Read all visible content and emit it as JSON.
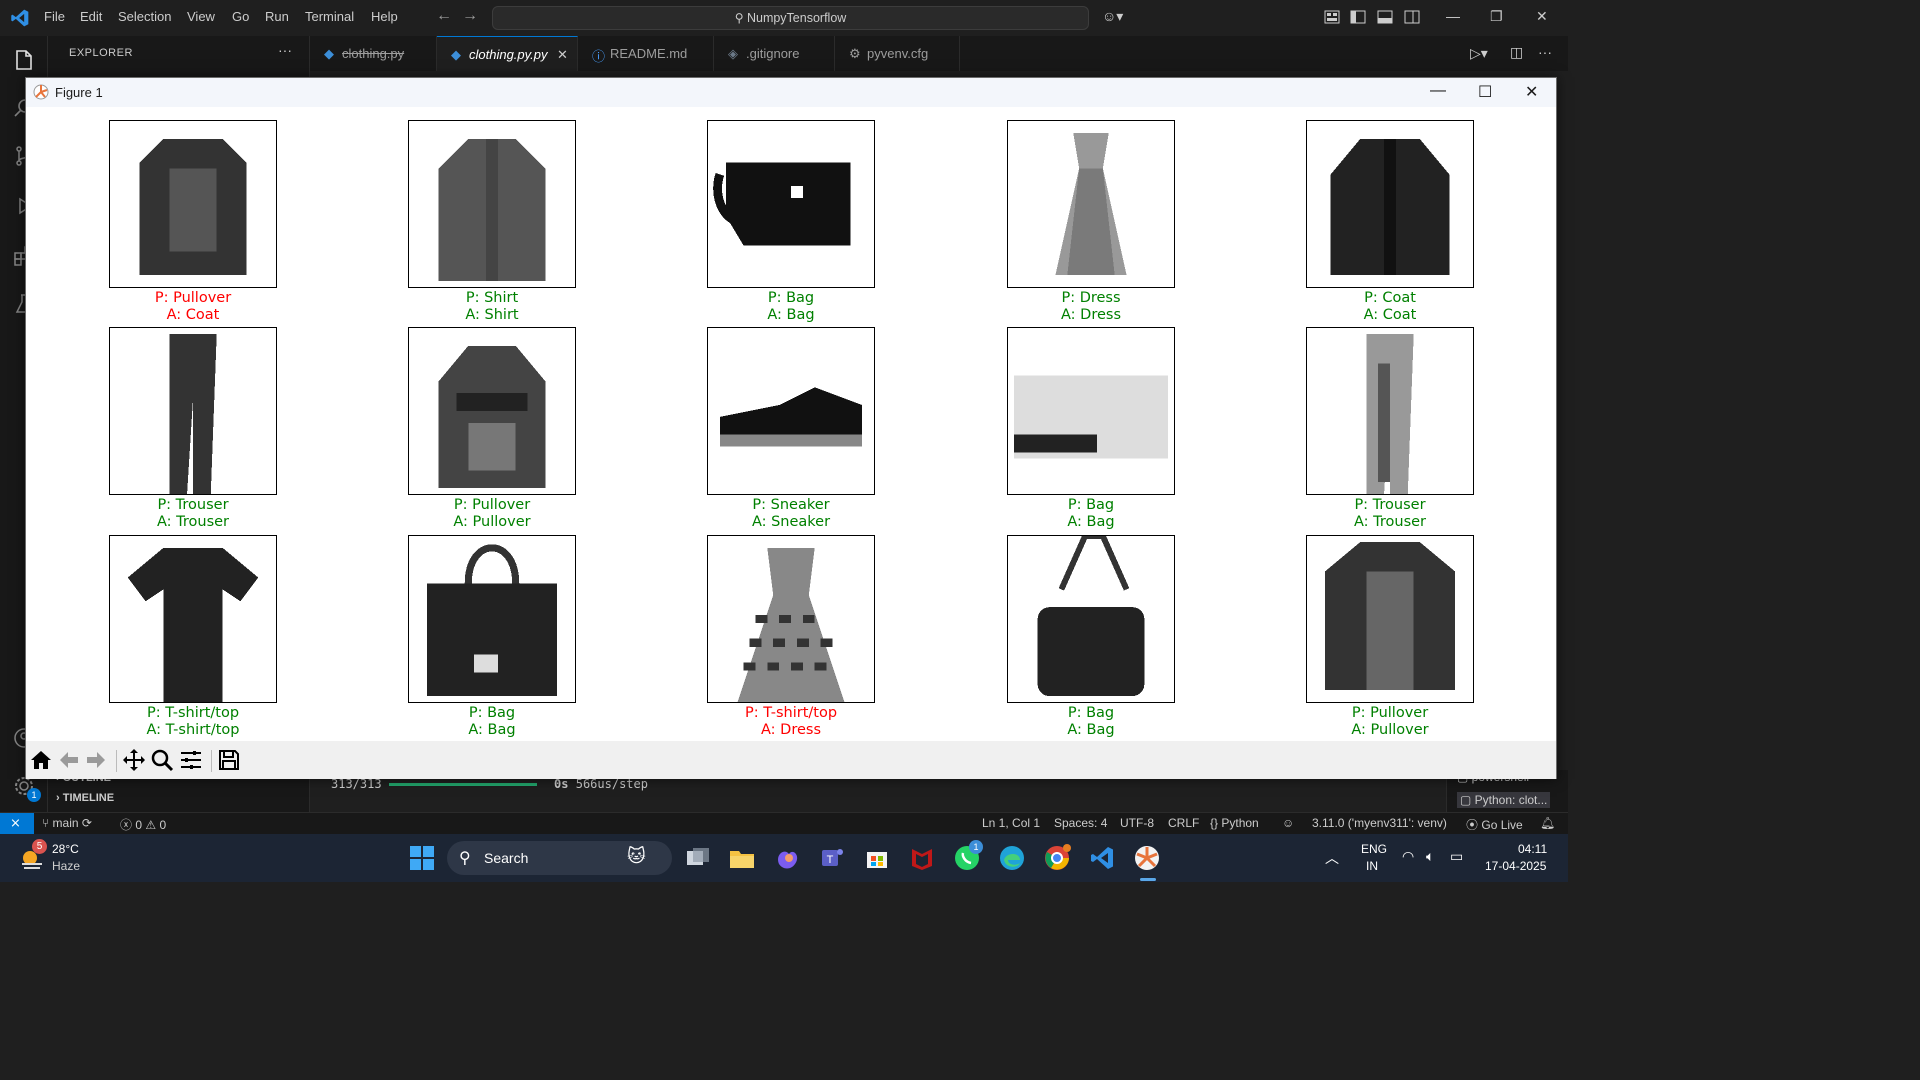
{
  "titlebar": {
    "menus": [
      "File",
      "Edit",
      "Selection",
      "View",
      "Go",
      "Run",
      "Terminal",
      "Help"
    ],
    "search_text": "NumpyTensorflow"
  },
  "sidebar": {
    "title": "EXPLORER",
    "more": "···",
    "outline": "OUTLINE",
    "timeline": "TIMELINE"
  },
  "tabs": [
    {
      "label": "clothing.py",
      "style": "deleted"
    },
    {
      "label": "clothing.py.py",
      "style": "active"
    },
    {
      "label": "README.md",
      "style": "normal"
    },
    {
      "label": ".gitignore",
      "style": "normal"
    },
    {
      "label": "pyvenv.cfg",
      "style": "normal"
    }
  ],
  "terminal": {
    "progress": "313/313",
    "time": "0s",
    "rate": "566us/step"
  },
  "right_panel": {
    "items": [
      "powershell",
      "Python: clot..."
    ]
  },
  "statusbar": {
    "branch": "main",
    "errors": "0",
    "warnings": "0",
    "position": "Ln 1, Col 1",
    "spaces": "Spaces: 4",
    "encoding": "UTF-8",
    "eol": "CRLF",
    "language": "Python",
    "interpreter": "3.11.0 ('myenv311': venv)",
    "golive": "Go Live",
    "accounts_badge": "1",
    "settings_badge": "1"
  },
  "figure": {
    "title": "Figure 1",
    "colors": {
      "correct": "#008000",
      "wrong": "#ff0000"
    },
    "grid": [
      {
        "pred": "P: Pullover",
        "actual": "A: Coat",
        "correct": false,
        "item": "coat"
      },
      {
        "pred": "P: Shirt",
        "actual": "A: Shirt",
        "correct": true,
        "item": "shirt"
      },
      {
        "pred": "P: Bag",
        "actual": "A: Bag",
        "correct": true,
        "item": "bag-flat"
      },
      {
        "pred": "P: Dress",
        "actual": "A: Dress",
        "correct": true,
        "item": "dress"
      },
      {
        "pred": "P: Coat",
        "actual": "A: Coat",
        "correct": true,
        "item": "coat-dark"
      },
      {
        "pred": "P: Trouser",
        "actual": "A: Trouser",
        "correct": true,
        "item": "trouser"
      },
      {
        "pred": "P: Pullover",
        "actual": "A: Pullover",
        "correct": true,
        "item": "pullover"
      },
      {
        "pred": "P: Sneaker",
        "actual": "A: Sneaker",
        "correct": true,
        "item": "sneaker"
      },
      {
        "pred": "P: Bag",
        "actual": "A: Bag",
        "correct": true,
        "item": "bag-clutch"
      },
      {
        "pred": "P: Trouser",
        "actual": "A: Trouser",
        "correct": true,
        "item": "trouser-light"
      },
      {
        "pred": "P: T-shirt/top",
        "actual": "A: T-shirt/top",
        "correct": true,
        "item": "tshirt"
      },
      {
        "pred": "P: Bag",
        "actual": "A: Bag",
        "correct": true,
        "item": "handbag"
      },
      {
        "pred": "P: T-shirt/top",
        "actual": "A: Dress",
        "correct": false,
        "item": "dress-pattern"
      },
      {
        "pred": "P: Bag",
        "actual": "A: Bag",
        "correct": true,
        "item": "handbag-2"
      },
      {
        "pred": "P: Pullover",
        "actual": "A: Pullover",
        "correct": true,
        "item": "pullover-2"
      }
    ]
  },
  "taskbar": {
    "weather_temp": "28°C",
    "weather_desc": "Haze",
    "weather_badge": "5",
    "search_label": "Search",
    "lang_line1": "ENG",
    "lang_line2": "IN",
    "time": "04:11",
    "date": "17-04-2025",
    "whatsapp_badge": "1"
  }
}
